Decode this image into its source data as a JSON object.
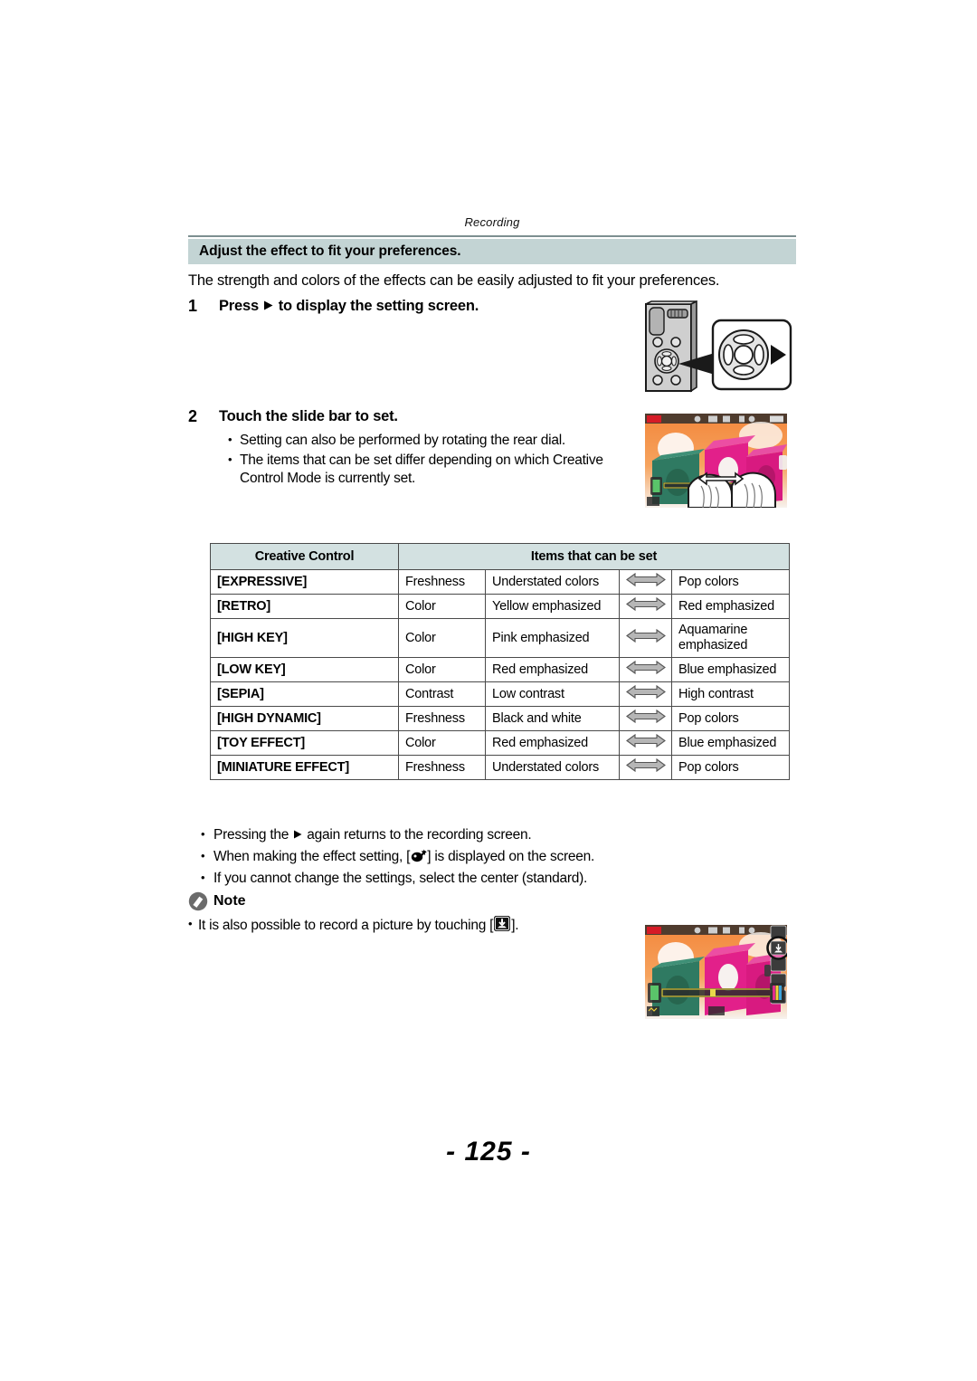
{
  "running_head": "Recording",
  "section": {
    "title": "Adjust the effect to fit your preferences.",
    "bar_color": "#c3d4d4"
  },
  "intro": "The strength and colors of the effects can be easily adjusted to fit your preferences.",
  "steps": [
    {
      "number": "1",
      "title_before": "Press",
      "title_after": "to display the setting screen.",
      "bullets": []
    },
    {
      "number": "2",
      "title_before": "Touch the slide bar to set.",
      "title_after": "",
      "bullets": [
        "Setting can also be performed by rotating the rear dial.",
        "The items that can be set differ depending on which Creative Control Mode is currently set."
      ]
    }
  ],
  "table": {
    "headers": [
      "Creative Control",
      "Items that can be set"
    ],
    "rows": [
      {
        "name": "[EXPRESSIVE]",
        "item": "Freshness",
        "left": "Understated colors",
        "arrow": "double-arrow-icon",
        "right": "Pop colors"
      },
      {
        "name": "[RETRO]",
        "item": "Color",
        "left": "Yellow emphasized",
        "arrow": "double-arrow-icon",
        "right": "Red emphasized"
      },
      {
        "name": "[HIGH KEY]",
        "item": "Color",
        "left": "Pink emphasized",
        "arrow": "double-arrow-icon",
        "right": "Aquamarine emphasized"
      },
      {
        "name": "[LOW KEY]",
        "item": "Color",
        "left": "Red emphasized",
        "arrow": "double-arrow-icon",
        "right": "Blue emphasized"
      },
      {
        "name": "[SEPIA]",
        "item": "Contrast",
        "left": "Low contrast",
        "arrow": "double-arrow-icon",
        "right": "High contrast"
      },
      {
        "name": "[HIGH DYNAMIC]",
        "item": "Freshness",
        "left": "Black and white",
        "arrow": "double-arrow-icon",
        "right": "Pop colors"
      },
      {
        "name": "[TOY EFFECT]",
        "item": "Color",
        "left": "Red emphasized",
        "arrow": "double-arrow-icon",
        "right": "Blue emphasized"
      },
      {
        "name": "[MINIATURE EFFECT]",
        "item": "Freshness",
        "left": "Understated colors",
        "arrow": "double-arrow-icon",
        "right": "Pop colors"
      }
    ],
    "header_bg": "#d3e1e1"
  },
  "post_bullets": {
    "b1_before": "Pressing the",
    "b1_after": "again returns to the recording screen.",
    "b2_before": "When making the effect setting, [",
    "b2_after": "] is displayed on the screen.",
    "b3": "If you cannot change the settings, select the center (standard)."
  },
  "note": {
    "label": "Note",
    "body_before": "It is also possible to record a picture by touching [",
    "body_after": "]."
  },
  "page_number": "- 125 -",
  "icons": {
    "cursor_right": "triangle-right-icon",
    "effect_setting": "effect-palette-icon",
    "touch_shutter": "touch-shutter-icon",
    "note_badge": "note-pencil-icon"
  }
}
